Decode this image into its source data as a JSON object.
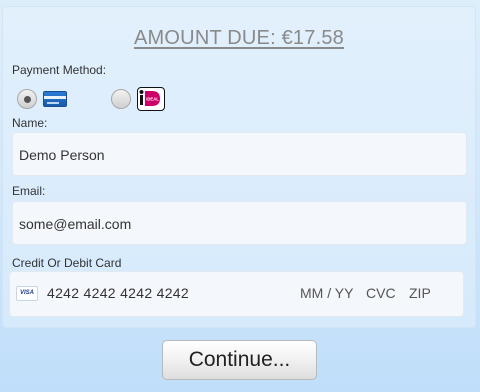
{
  "header": {
    "amount_due": "AMOUNT DUE: €17.58"
  },
  "payment_method": {
    "label": "Payment Method:",
    "options": [
      {
        "icon": "credit-card-icon",
        "selected": true
      },
      {
        "icon": "ideal-icon",
        "selected": false
      }
    ]
  },
  "form": {
    "name_label": "Name:",
    "name_value": "Demo Person",
    "email_label": "Email:",
    "email_value": "some@email.com",
    "card_label": "Credit Or Debit Card",
    "card_brand": "VISA",
    "card_number": "4242 4242 4242 4242",
    "expiry_placeholder": "MM / YY",
    "cvc_placeholder": "CVC",
    "zip_placeholder": "ZIP"
  },
  "actions": {
    "continue_label": "Continue..."
  },
  "colors": {
    "background": "#cfe6fb",
    "amount_text": "#8a8a8a",
    "field_bg": "#f4f8fc",
    "ideal_pink": "#cc0066"
  }
}
